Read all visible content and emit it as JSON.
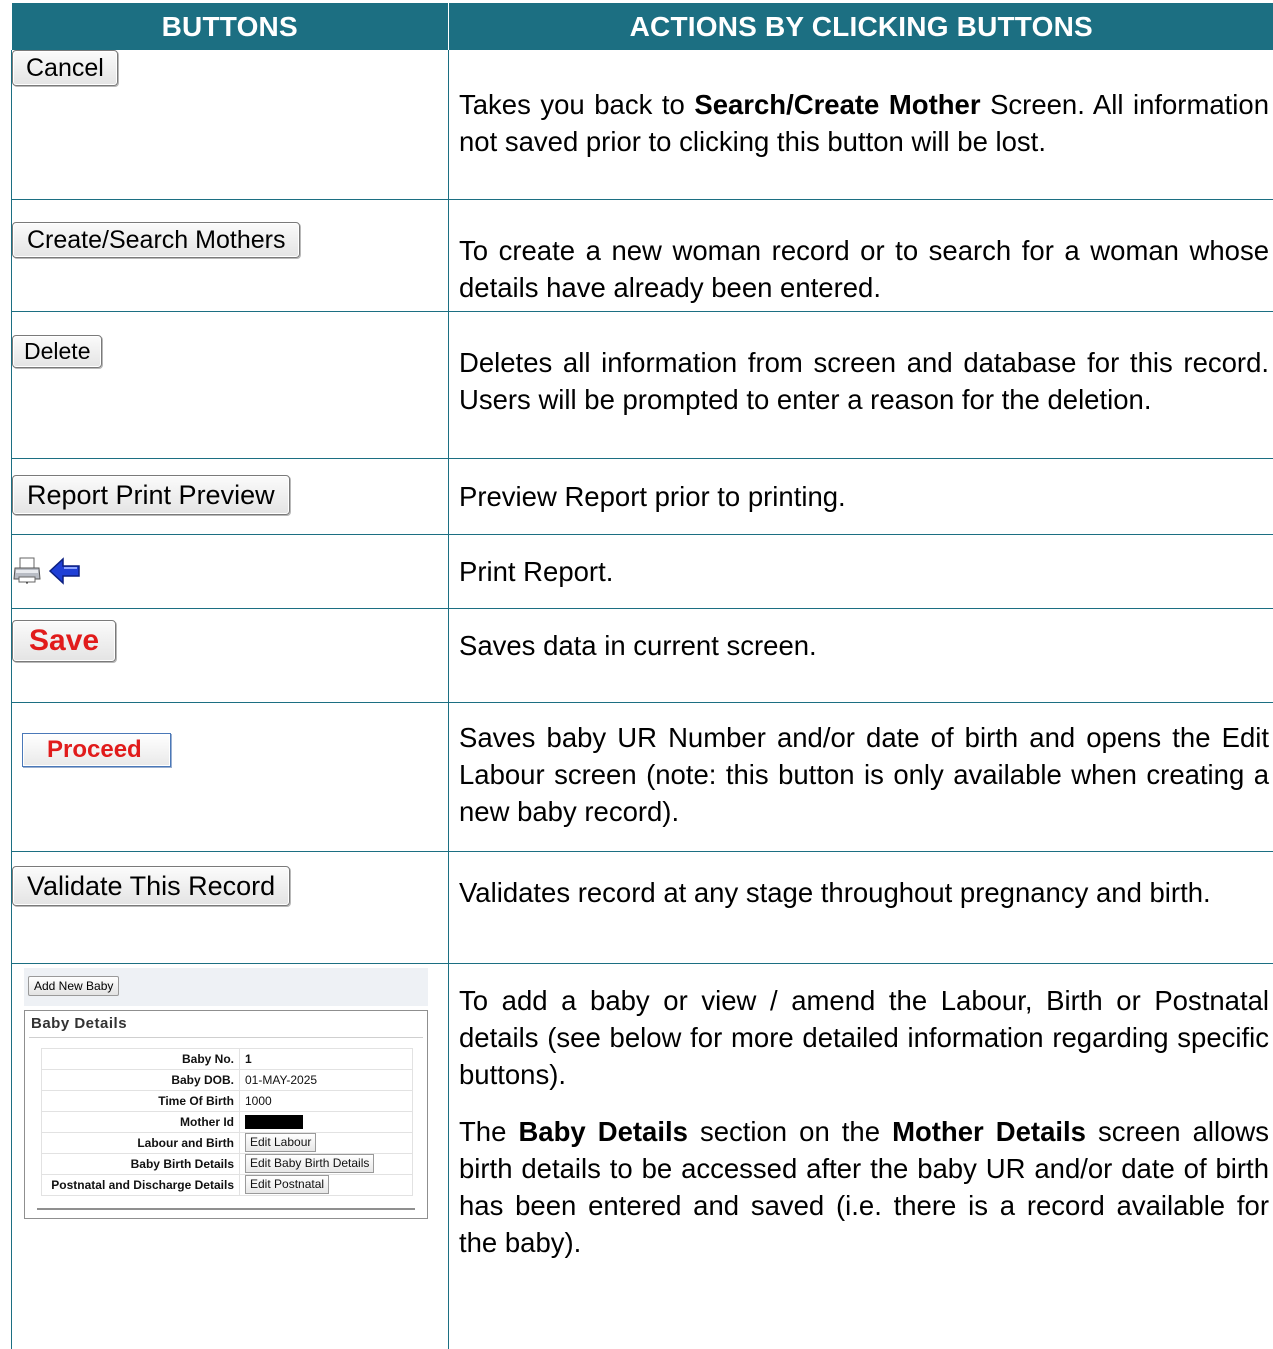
{
  "header": {
    "col1": "BUTTONS",
    "col2": "ACTIONS BY CLICKING BUTTONS"
  },
  "rows": [
    {
      "button": "Cancel",
      "desc_parts": [
        "Takes you back to ",
        "Search/Create Mother",
        " Screen. All information not saved prior to clicking this button will be lost."
      ]
    },
    {
      "button": "Create/Search Mothers",
      "desc": "To create a new woman record or to search for a woman whose details have already been entered."
    },
    {
      "button": "Delete",
      "desc": "Deletes all information from screen and database for this record. Users will be prompted to enter a reason for the deletion."
    },
    {
      "button": "Report Print Preview",
      "desc": "Preview Report prior to printing."
    },
    {
      "icons": [
        "printer-icon",
        "left-arrow-icon"
      ],
      "desc": "Print Report."
    },
    {
      "button": "Save",
      "desc": "Saves data in current screen."
    },
    {
      "button": "Proceed",
      "desc": "Saves baby UR Number and/or date of birth and opens the Edit Labour screen (note: this button is only available when creating a new baby record)."
    },
    {
      "button": "Validate This Record",
      "desc": "Validates record at any stage throughout pregnancy and birth."
    },
    {
      "panel": {
        "add_button": "Add New Baby",
        "title": "Baby Details",
        "fields": [
          {
            "label": "Baby No.",
            "value": "1"
          },
          {
            "label": "Baby DOB.",
            "value": "01-MAY-2025"
          },
          {
            "label": "Time Of Birth",
            "value": "1000"
          },
          {
            "label": "Mother Id",
            "value": ""
          },
          {
            "label": "Labour and Birth",
            "button": "Edit Labour"
          },
          {
            "label": "Baby Birth Details",
            "button": "Edit Baby Birth Details"
          },
          {
            "label": "Postnatal and Discharge Details",
            "button": "Edit Postnatal"
          }
        ]
      },
      "desc1": "To add a baby or view / amend the Labour, Birth or Postnatal details (see below for more detailed information regarding specific buttons).",
      "desc2_parts": [
        "The ",
        "Baby Details",
        " section on the ",
        "Mother Details",
        " screen allows birth details to be accessed after the baby UR and/or date of birth has been entered and saved (i.e. there is a record available for the baby)."
      ]
    }
  ],
  "colors": {
    "header_bg": "#1c6f82",
    "header_text": "#ffffff",
    "save_red": "#e11b1b"
  }
}
